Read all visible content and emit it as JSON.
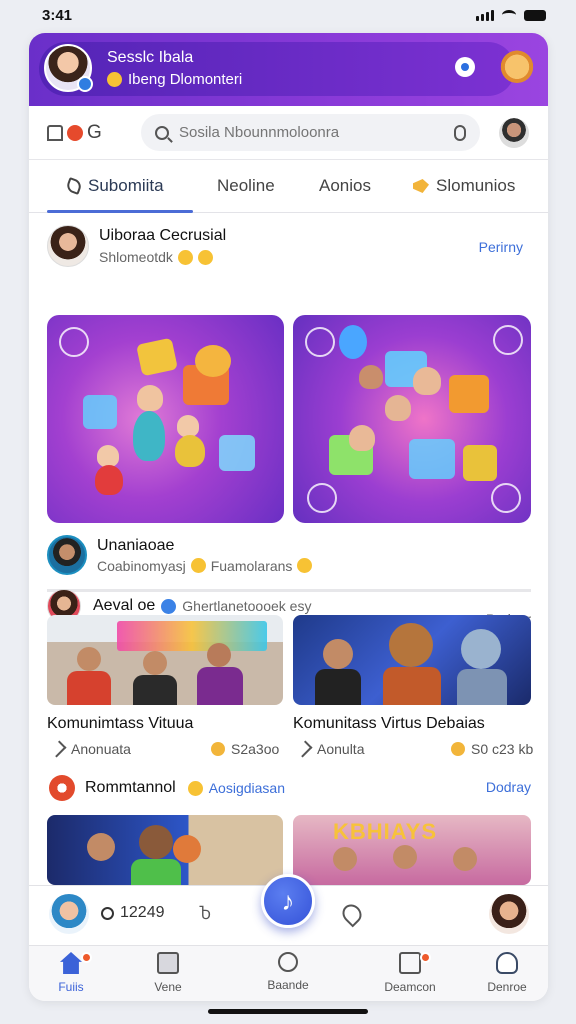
{
  "status": {
    "time": "3:41"
  },
  "hero": {
    "title": "Sesslc Ibala",
    "subtitle": "Ibeng Dlomonteri"
  },
  "search": {
    "placeholder": "Sosila Nbounnmoloonra",
    "brand": "G"
  },
  "tabs": [
    {
      "label": "Subomiita"
    },
    {
      "label": "Neoline"
    },
    {
      "label": "Aonios"
    },
    {
      "label": "Slomunios"
    }
  ],
  "post1": {
    "name": "Uiboraa Cecrusial",
    "sub": "Shlomeotdk",
    "action": "Perirny"
  },
  "post2": {
    "name": "Unaniaoae",
    "sub": "Coabinomyasj",
    "sub2": "Fuamolarans"
  },
  "post3": {
    "name": "Aeval oe",
    "sub": "Ghertlanetoooek esy",
    "action": "Podnar"
  },
  "cards": [
    {
      "title": "Komunimtass Vituua",
      "meta": "Anonuata",
      "meta2": "S2a3oo"
    },
    {
      "title": "Komunitass Virtus  Debaias",
      "meta": "Aonulta",
      "meta2": "S0 c23 kb"
    }
  ],
  "post4": {
    "name": "Rommtannol",
    "sub": "Aosigdiasan",
    "action": "Dodray"
  },
  "photo_d_text": "KBHIAYS",
  "bottom": {
    "count": "12249",
    "share": "Ⴆ"
  },
  "nav": [
    {
      "label": "Fuiis"
    },
    {
      "label": "Vene"
    },
    {
      "label": "Baande"
    },
    {
      "label": "Deamcon"
    },
    {
      "label": "Denroe"
    }
  ],
  "colors": {
    "accent": "#3b62d8",
    "hero": "#6a2fc9",
    "link": "#3d6fd9"
  }
}
